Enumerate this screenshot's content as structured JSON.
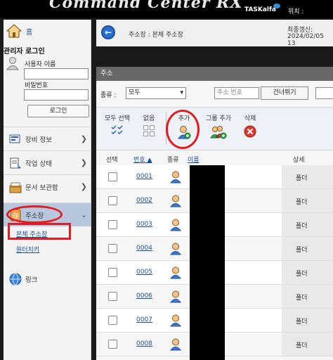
{
  "header": {
    "logo_text": "Command Center RX",
    "brand": "TASKalfa",
    "location_label": "위치 :"
  },
  "sidebar": {
    "home_label": "홈",
    "admin_login_title": "관리자 로그인",
    "username_label": "사용자 이름",
    "password_label": "비밀번호",
    "login_button": "로그인",
    "nav": [
      {
        "label": "장비 정보",
        "icon": "device-info-icon"
      },
      {
        "label": "작업 상태",
        "icon": "job-status-icon"
      },
      {
        "label": "문서 보관함",
        "icon": "document-box-icon"
      },
      {
        "label": "주소장",
        "icon": "address-book-icon"
      },
      {
        "label": "링크",
        "icon": "globe-link-icon"
      }
    ],
    "sub_items": [
      "본체 주소장",
      "원터치키"
    ]
  },
  "breadcrumb": {
    "text": "주소장 : 본체 주소장",
    "last_update_label": "최종갱신:",
    "last_update_value": "2024/02/05 13"
  },
  "panel": {
    "title": "주소",
    "type_label": "종류 :",
    "type_selected": "모두",
    "address_no_placeholder": "주소 번호",
    "skip_button": "건너뛰기",
    "toolbar": {
      "select_all": "모두 선택",
      "none": "없음",
      "add": "추가",
      "group_add": "그룹 추가",
      "delete": "삭제"
    },
    "columns": {
      "select": "선택",
      "number": "번호",
      "type": "종류",
      "name": "이름",
      "detail": "상세"
    },
    "rows": [
      {
        "number": "0001",
        "detail": "폴더"
      },
      {
        "number": "0002",
        "detail": "폴더"
      },
      {
        "number": "0003",
        "detail": "폴더"
      },
      {
        "number": "0004",
        "detail": "폴더"
      },
      {
        "number": "0005",
        "detail": "폴더"
      },
      {
        "number": "0006",
        "detail": "폴더"
      },
      {
        "number": "0007",
        "detail": "폴더"
      },
      {
        "number": "0008",
        "detail": "폴더"
      }
    ]
  },
  "colors": {
    "highlight_red": "#e31b23",
    "link_blue": "#1a4e9a",
    "selected_nav": "#b6c7de",
    "panel_header": "#686868"
  }
}
